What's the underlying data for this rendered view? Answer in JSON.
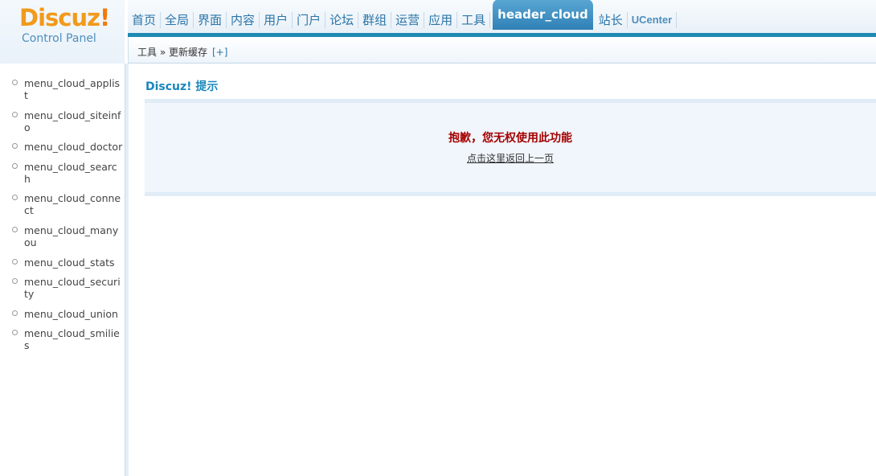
{
  "header": {
    "logo_brand": "Discuz",
    "logo_bang": "!",
    "logo_sub": "Control Panel",
    "nav": [
      {
        "label": "首页"
      },
      {
        "label": "全局"
      },
      {
        "label": "界面"
      },
      {
        "label": "内容"
      },
      {
        "label": "用户"
      },
      {
        "label": "门户"
      },
      {
        "label": "论坛"
      },
      {
        "label": "群组"
      },
      {
        "label": "运营"
      },
      {
        "label": "应用"
      },
      {
        "label": "工具"
      },
      {
        "label": "header_cloud",
        "active": true
      },
      {
        "label": "站长"
      },
      {
        "label": "UCenter"
      }
    ]
  },
  "breadcrumb": {
    "text": "工具 » 更新缓存",
    "plus": "[+]"
  },
  "sidebar": {
    "items": [
      {
        "label": "menu_cloud_applist"
      },
      {
        "label": "menu_cloud_siteinfo"
      },
      {
        "label": "menu_cloud_doctor"
      },
      {
        "label": "menu_cloud_search"
      },
      {
        "label": "menu_cloud_connect"
      },
      {
        "label": "menu_cloud_manyou"
      },
      {
        "label": "menu_cloud_stats"
      },
      {
        "label": "menu_cloud_security"
      },
      {
        "label": "menu_cloud_union"
      },
      {
        "label": "menu_cloud_smilies"
      }
    ]
  },
  "main": {
    "title": "Discuz! 提示",
    "message": "抱歉，您无权使用此功能",
    "back_link": "点击这里返回上一页"
  },
  "colors": {
    "nav_active": "#2f80b6",
    "accent": "#1a87bd",
    "error": "#a50000",
    "logo": "#f29a1b"
  }
}
